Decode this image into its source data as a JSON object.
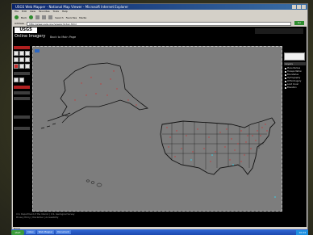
{
  "window": {
    "title": "USGS Web Mapper - National Map Viewer - Microsoft Internet Explorer",
    "menu": [
      "File",
      "Edit",
      "View",
      "Favorites",
      "Tools",
      "Help"
    ],
    "toolbar": [
      "Back",
      "Search",
      "Favorites",
      "Media"
    ],
    "address_label": "Address",
    "address_value": "http://www.usgs.gov/viewer/index.html",
    "go_label": "Go"
  },
  "header": {
    "logo": "USGS",
    "app_title": "Online Imagery",
    "back_link": "Back to Main Page"
  },
  "layers": {
    "title": "Layers",
    "items": [
      "Place Names",
      "Transportation",
      "Boundaries",
      "Hydrography",
      "Orthoimagery",
      "Land Cover",
      "Elevation"
    ]
  },
  "footer": {
    "line1": "U.S. Department of the Interior | U.S. Geological Survey",
    "line2": "Privacy Policy | Disclaimer | Accessibility"
  },
  "status": "Done",
  "taskbar": {
    "start": "start",
    "items": [
      "Inbox",
      "Web Mapper",
      "Document"
    ],
    "clock": "10:24"
  }
}
